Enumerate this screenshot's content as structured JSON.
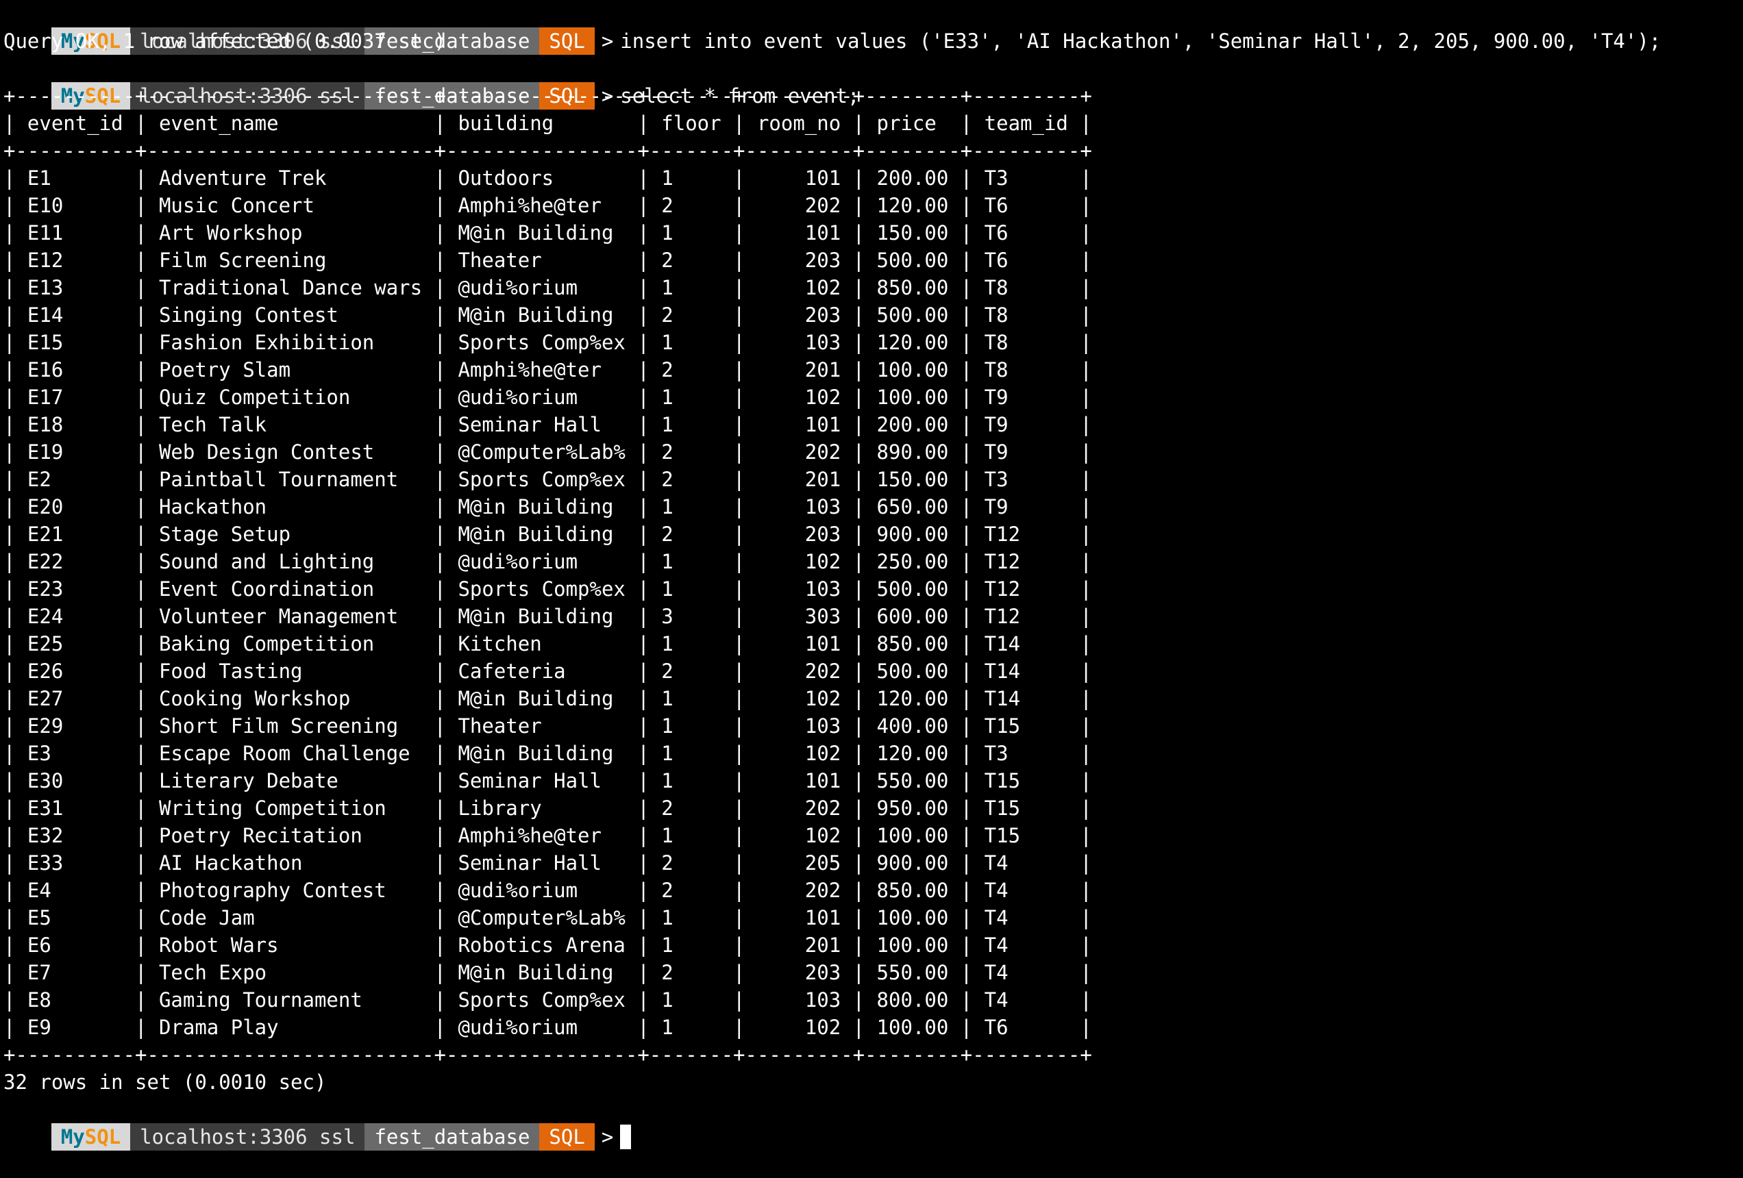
{
  "prompt": {
    "mysql_a": "My",
    "mysql_b": "SQL",
    "host": "localhost:3306 ssl",
    "database": "fest_database",
    "mode": "SQL",
    "arrow": ">"
  },
  "commands": {
    "insert": "insert into event values ('E33', 'AI Hackathon', 'Seminar Hall', 2, 205, 900.00, 'T4');",
    "insert_result": "Query OK, 1 row affected (0.0037 sec)",
    "select": "select * from event;",
    "select_result": "32 rows in set (0.0010 sec)"
  },
  "table": {
    "columns": [
      "event_id",
      "event_name",
      "building",
      "floor",
      "room_no",
      "price",
      "team_id"
    ],
    "rows": [
      [
        "E1",
        "Adventure Trek",
        "Outdoors",
        "1",
        "101",
        "200.00",
        "T3"
      ],
      [
        "E10",
        "Music Concert",
        "Amphi%he@ter",
        "2",
        "202",
        "120.00",
        "T6"
      ],
      [
        "E11",
        "Art Workshop",
        "M@in Building",
        "1",
        "101",
        "150.00",
        "T6"
      ],
      [
        "E12",
        "Film Screening",
        "Theater",
        "2",
        "203",
        "500.00",
        "T6"
      ],
      [
        "E13",
        "Traditional Dance wars",
        "@udi%orium",
        "1",
        "102",
        "850.00",
        "T8"
      ],
      [
        "E14",
        "Singing Contest",
        "M@in Building",
        "2",
        "203",
        "500.00",
        "T8"
      ],
      [
        "E15",
        "Fashion Exhibition",
        "Sports Comp%ex",
        "1",
        "103",
        "120.00",
        "T8"
      ],
      [
        "E16",
        "Poetry Slam",
        "Amphi%he@ter",
        "2",
        "201",
        "100.00",
        "T8"
      ],
      [
        "E17",
        "Quiz Competition",
        "@udi%orium",
        "1",
        "102",
        "100.00",
        "T9"
      ],
      [
        "E18",
        "Tech Talk",
        "Seminar Hall",
        "1",
        "101",
        "200.00",
        "T9"
      ],
      [
        "E19",
        "Web Design Contest",
        "@Computer%Lab%",
        "2",
        "202",
        "890.00",
        "T9"
      ],
      [
        "E2",
        "Paintball Tournament",
        "Sports Comp%ex",
        "2",
        "201",
        "150.00",
        "T3"
      ],
      [
        "E20",
        "Hackathon",
        "M@in Building",
        "1",
        "103",
        "650.00",
        "T9"
      ],
      [
        "E21",
        "Stage Setup",
        "M@in Building",
        "2",
        "203",
        "900.00",
        "T12"
      ],
      [
        "E22",
        "Sound and Lighting",
        "@udi%orium",
        "1",
        "102",
        "250.00",
        "T12"
      ],
      [
        "E23",
        "Event Coordination",
        "Sports Comp%ex",
        "1",
        "103",
        "500.00",
        "T12"
      ],
      [
        "E24",
        "Volunteer Management",
        "M@in Building",
        "3",
        "303",
        "600.00",
        "T12"
      ],
      [
        "E25",
        "Baking Competition",
        "Kitchen",
        "1",
        "101",
        "850.00",
        "T14"
      ],
      [
        "E26",
        "Food Tasting",
        "Cafeteria",
        "2",
        "202",
        "500.00",
        "T14"
      ],
      [
        "E27",
        "Cooking Workshop",
        "M@in Building",
        "1",
        "102",
        "120.00",
        "T14"
      ],
      [
        "E29",
        "Short Film Screening",
        "Theater",
        "1",
        "103",
        "400.00",
        "T15"
      ],
      [
        "E3",
        "Escape Room Challenge",
        "M@in Building",
        "1",
        "102",
        "120.00",
        "T3"
      ],
      [
        "E30",
        "Literary Debate",
        "Seminar Hall",
        "1",
        "101",
        "550.00",
        "T15"
      ],
      [
        "E31",
        "Writing Competition",
        "Library",
        "2",
        "202",
        "950.00",
        "T15"
      ],
      [
        "E32",
        "Poetry Recitation",
        "Amphi%he@ter",
        "1",
        "102",
        "100.00",
        "T15"
      ],
      [
        "E33",
        "AI Hackathon",
        "Seminar Hall",
        "2",
        "205",
        "900.00",
        "T4"
      ],
      [
        "E4",
        "Photography Contest",
        "@udi%orium",
        "2",
        "202",
        "850.00",
        "T4"
      ],
      [
        "E5",
        "Code Jam",
        "@Computer%Lab%",
        "1",
        "101",
        "100.00",
        "T4"
      ],
      [
        "E6",
        "Robot Wars",
        "Robotics Arena",
        "1",
        "201",
        "100.00",
        "T4"
      ],
      [
        "E7",
        "Tech Expo",
        "M@in Building",
        "2",
        "203",
        "550.00",
        "T4"
      ],
      [
        "E8",
        "Gaming Tournament",
        "Sports Comp%ex",
        "1",
        "103",
        "800.00",
        "T4"
      ],
      [
        "E9",
        "Drama Play",
        "@udi%orium",
        "1",
        "102",
        "100.00",
        "T6"
      ]
    ]
  }
}
